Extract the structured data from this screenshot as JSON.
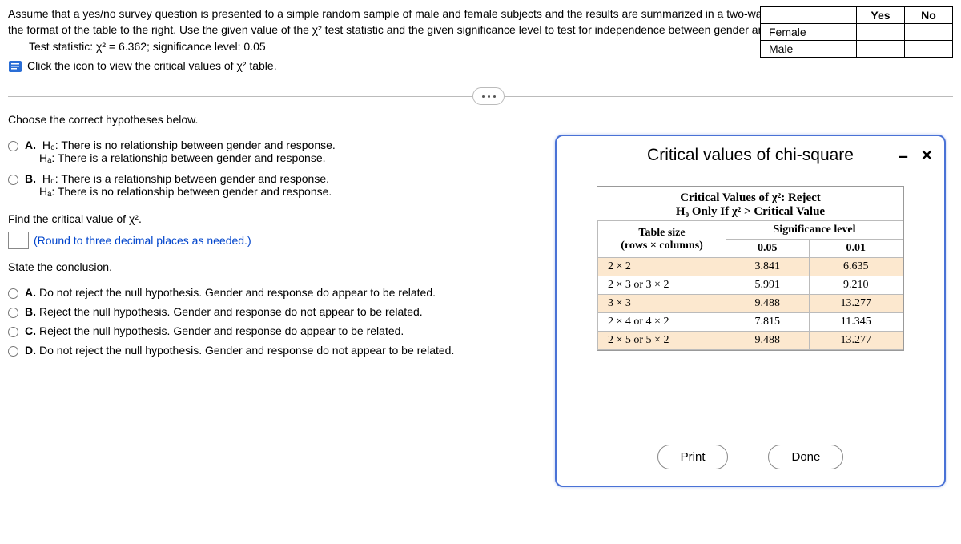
{
  "problem": {
    "text": "Assume that a yes/no survey question is presented to a simple random sample of male and female subjects and the results are summarized in a two-way table with the format of the table to the right. Use the given value of the χ² test statistic and the given significance level to test for independence between gender and response.",
    "test_statistic_line": "Test statistic: χ² = 6.362; significance level: 0.05",
    "click_line": "Click the icon to view the critical values of χ² table."
  },
  "yn_table": {
    "col1": "Yes",
    "col2": "No",
    "row1": "Female",
    "row2": "Male"
  },
  "q1_prompt": "Choose the correct hypotheses below.",
  "q1_options": {
    "A": {
      "h0": "H₀: There is no relationship between gender and response.",
      "ha": "Hₐ: There is a relationship between gender and response."
    },
    "B": {
      "h0": "H₀: There is a relationship between gender and response.",
      "ha": "Hₐ: There is no relationship between gender and response."
    }
  },
  "find_cv": "Find the critical value of χ².",
  "round_note": "(Round to three decimal places as needed.)",
  "state_conclusion": "State the conclusion.",
  "conclusion_options": {
    "A": "Do not reject the null hypothesis. Gender and response do appear to be related.",
    "B": "Reject the null hypothesis. Gender and response do not appear to be related.",
    "C": "Reject the null hypothesis. Gender and response do appear to be related.",
    "D": "Do not reject the null hypothesis. Gender and response do not appear to be related."
  },
  "modal": {
    "title": "Critical values of chi-square",
    "caption_line1": "Critical Values of χ²: Reject",
    "caption_line2": "H₀ Only If χ² > Critical Value",
    "header_size1": "Table size",
    "header_size2": "(rows × columns)",
    "header_sig": "Significance level",
    "sig_005": "0.05",
    "sig_001": "0.01",
    "rows": [
      {
        "size": "2 × 2",
        "v05": "3.841",
        "v01": "6.635"
      },
      {
        "size": "2 × 3 or 3 × 2",
        "v05": "5.991",
        "v01": "9.210"
      },
      {
        "size": "3 × 3",
        "v05": "9.488",
        "v01": "13.277"
      },
      {
        "size": "2 × 4 or 4 × 2",
        "v05": "7.815",
        "v01": "11.345"
      },
      {
        "size": "2 × 5 or 5 × 2",
        "v05": "9.488",
        "v01": "13.277"
      }
    ],
    "print_label": "Print",
    "done_label": "Done"
  },
  "chart_data": {
    "type": "table",
    "title": "Critical Values of χ²: Reject H₀ Only If χ² > Critical Value",
    "columns": [
      "Table size (rows × columns)",
      "Significance level 0.05",
      "Significance level 0.01"
    ],
    "rows": [
      [
        "2 × 2",
        3.841,
        6.635
      ],
      [
        "2 × 3 or 3 × 2",
        5.991,
        9.21
      ],
      [
        "3 × 3",
        9.488,
        13.277
      ],
      [
        "2 × 4 or 4 × 2",
        7.815,
        11.345
      ],
      [
        "2 × 5 or 5 × 2",
        9.488,
        13.277
      ]
    ]
  }
}
